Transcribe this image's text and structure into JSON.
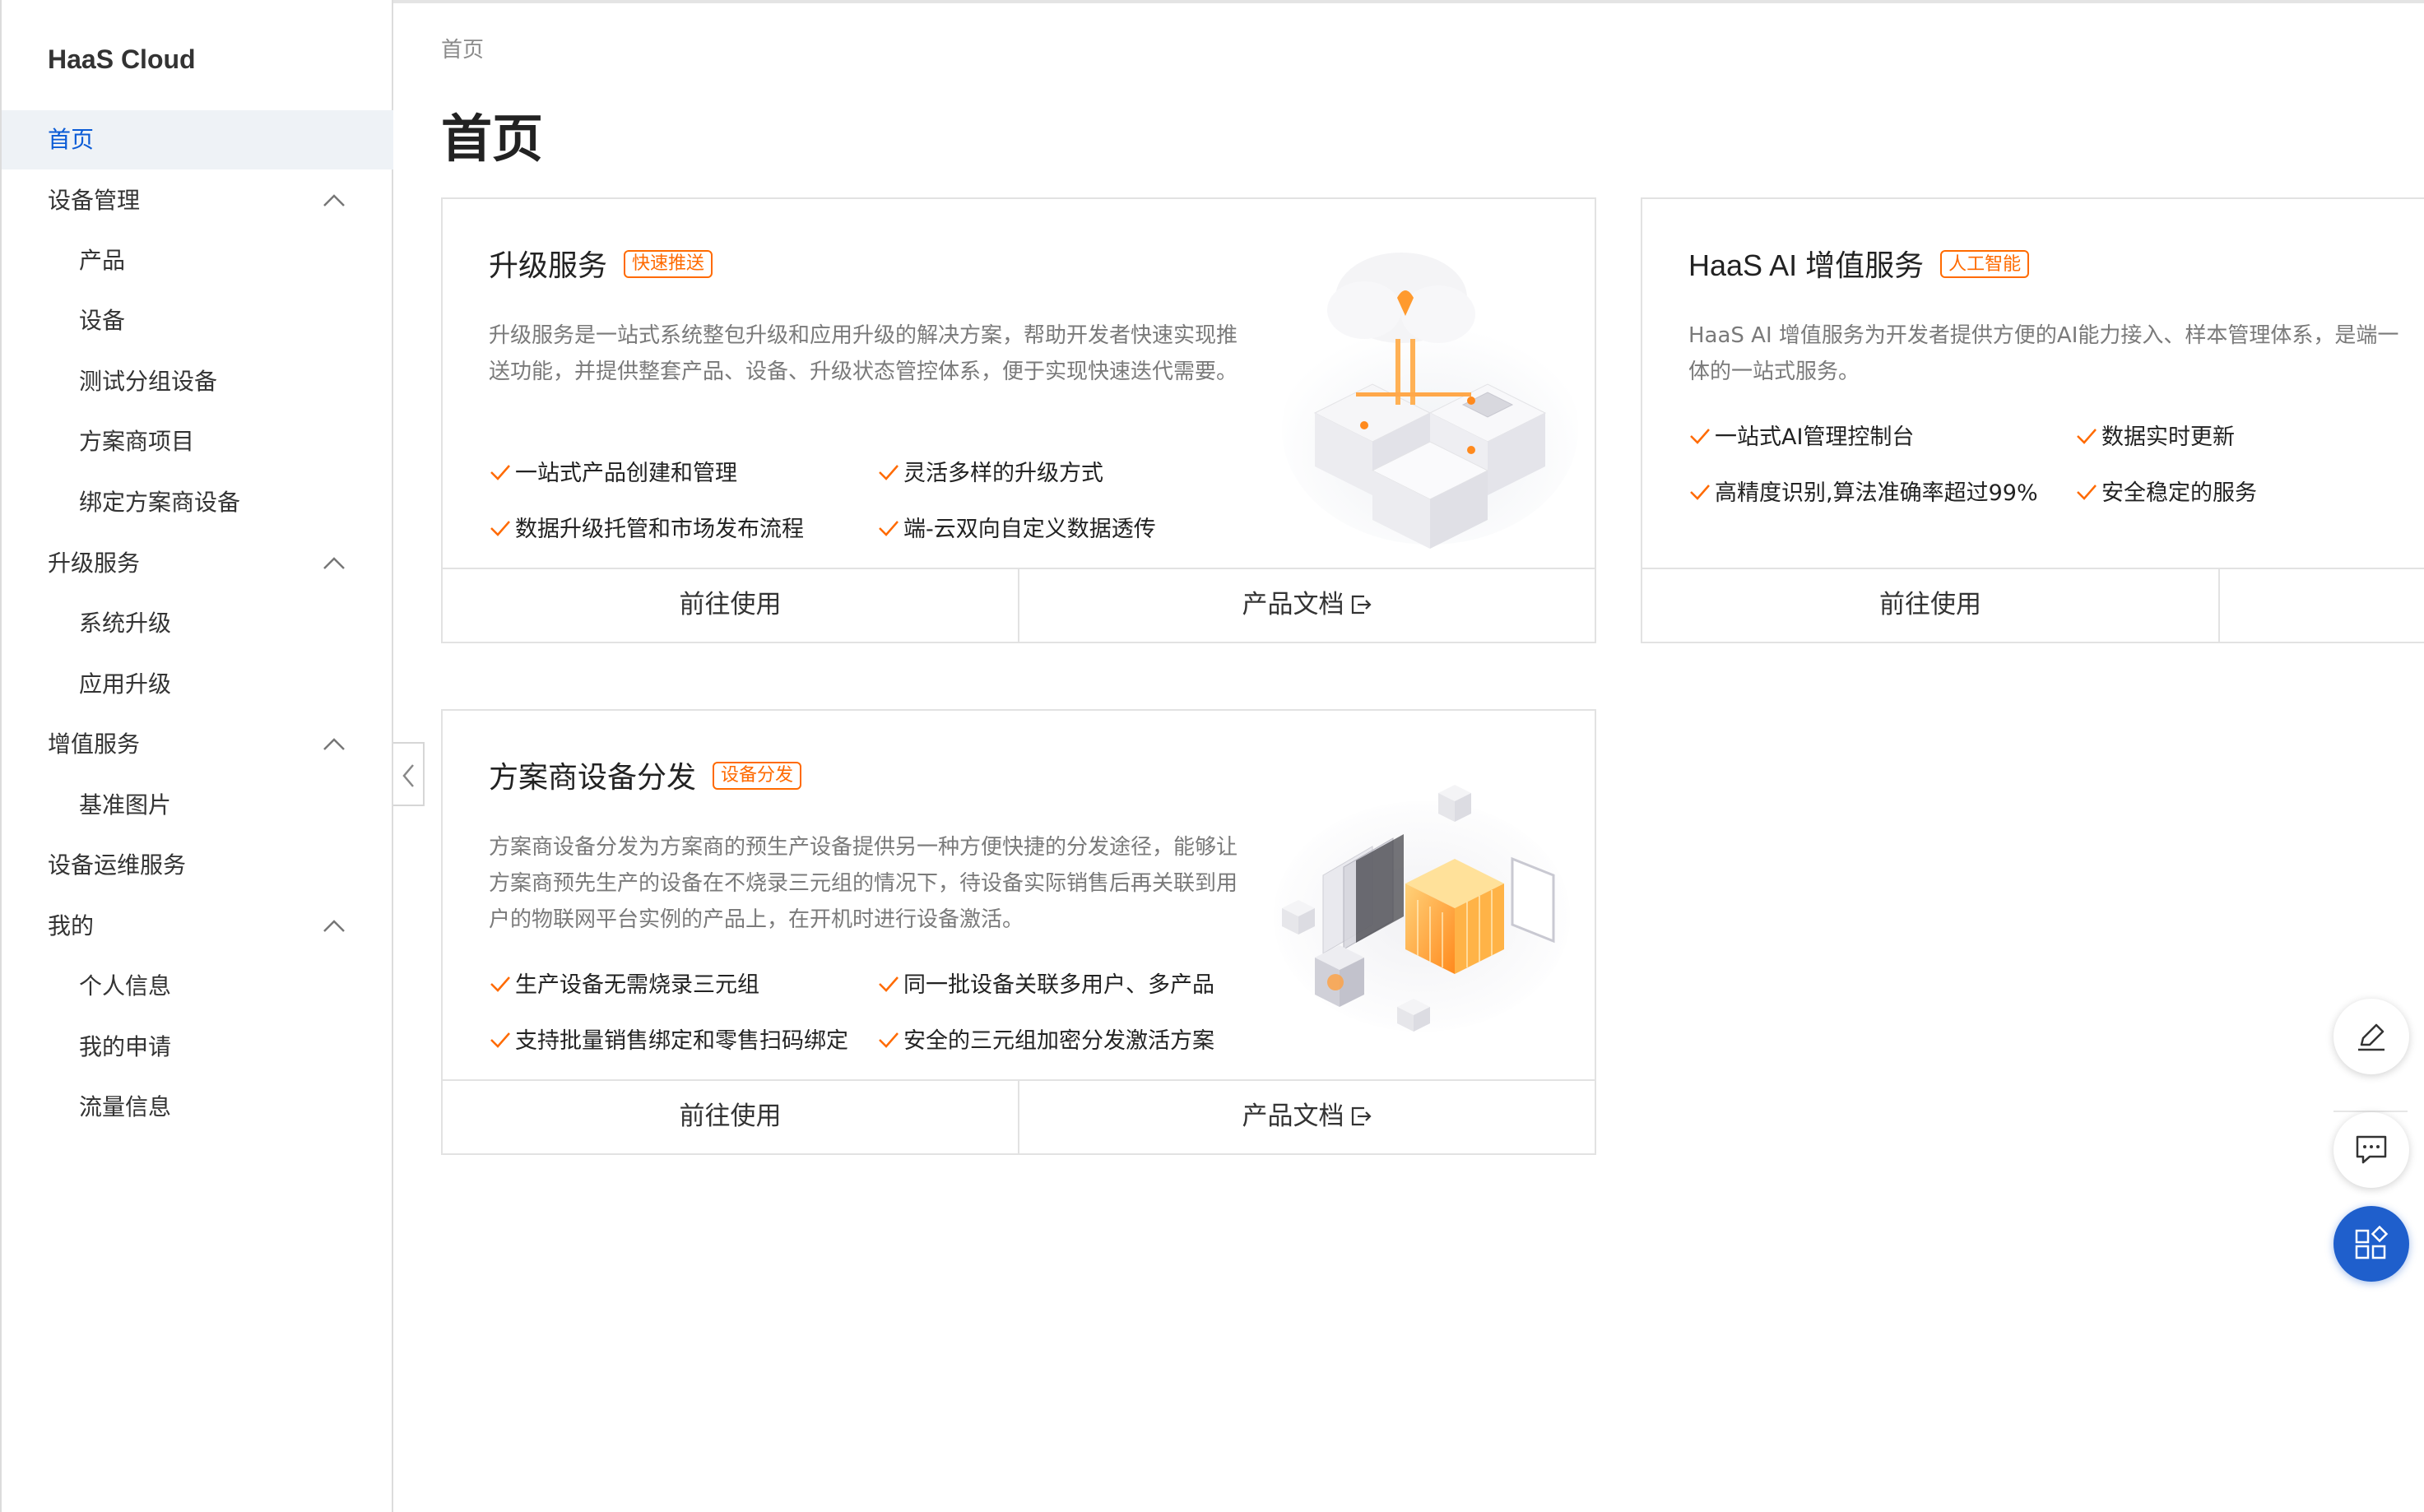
{
  "sidebar": {
    "brand": "HaaS Cloud",
    "items": [
      {
        "label": "首页",
        "level": 1,
        "active": true
      },
      {
        "label": "设备管理",
        "level": 1,
        "expanded": true
      },
      {
        "label": "产品",
        "level": 2
      },
      {
        "label": "设备",
        "level": 2
      },
      {
        "label": "测试分组设备",
        "level": 2
      },
      {
        "label": "方案商项目",
        "level": 2
      },
      {
        "label": "绑定方案商设备",
        "level": 2
      },
      {
        "label": "升级服务",
        "level": 1,
        "expanded": true
      },
      {
        "label": "系统升级",
        "level": 2
      },
      {
        "label": "应用升级",
        "level": 2
      },
      {
        "label": "增值服务",
        "level": 1,
        "expanded": true
      },
      {
        "label": "基准图片",
        "level": 2
      },
      {
        "label": "设备运维服务",
        "level": 1
      },
      {
        "label": "我的",
        "level": 1,
        "expanded": true
      },
      {
        "label": "个人信息",
        "level": 2
      },
      {
        "label": "我的申请",
        "level": 2
      },
      {
        "label": "流量信息",
        "level": 2
      }
    ]
  },
  "breadcrumb": "首页",
  "page_title": "首页",
  "cards": {
    "upgrade": {
      "title": "升级服务",
      "tag": "快速推送",
      "description": "升级服务是一站式系统整包升级和应用升级的解决方案，帮助开发者快速实现推送功能，并提供整套产品、设备、升级状态管控体系，便于实现快速迭代需要。",
      "features": [
        "一站式产品创建和管理",
        "灵活多样的升级方式",
        "数据升级托管和市场发布流程",
        "端-云双向自定义数据透传"
      ],
      "primary_button": "前往使用",
      "doc_button": "产品文档"
    },
    "ai": {
      "title": "HaaS AI 增值服务",
      "tag": "人工智能",
      "description": "HaaS AI 增值服务为开发者提供方便的AI能力接入、样本管理体系，是端一体的一站式服务。",
      "features": [
        "一站式AI管理控制台",
        "数据实时更新",
        "高精度识别,算法准确率超过99%",
        "安全稳定的服务"
      ],
      "primary_button": "前往使用"
    },
    "dist": {
      "title": "方案商设备分发",
      "tag": "设备分发",
      "description": "方案商设备分发为方案商的预生产设备提供另一种方便快捷的分发途径，能够让方案商预先生产的设备在不烧录三元组的情况下，待设备实际销售后再关联到用户的物联网平台实例的产品上，在开机时进行设备激活。",
      "features": [
        "生产设备无需烧录三元组",
        "同一批设备关联多用户、多产品",
        "支持批量销售绑定和零售扫码绑定",
        "安全的三元组加密分发激活方案"
      ],
      "primary_button": "前往使用",
      "doc_button": "产品文档"
    }
  },
  "colors": {
    "accent": "#ff6a00",
    "nav_active": "#0a5bd6",
    "fab_primary": "#1f5fcc"
  },
  "icons": {
    "chevron": "chevron-up-icon",
    "check": "check-icon",
    "external": "external-link-icon",
    "edit": "edit-icon",
    "chat": "chat-icon",
    "apps": "apps-icon"
  }
}
